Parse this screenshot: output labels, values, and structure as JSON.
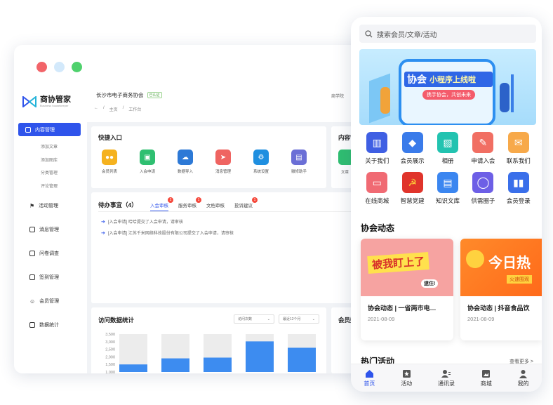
{
  "desktop": {
    "logo": {
      "title": "商协管家",
      "subtitle": "Business housekeeper"
    },
    "sidebar": {
      "active": "内容管理",
      "subitems": [
        "添加文章",
        "添加图库",
        "分类管理",
        "评论管理"
      ],
      "items": [
        "活动管理",
        "消息管理",
        "问卷调查",
        "签到管理",
        "会员管理",
        "数据统计"
      ]
    },
    "header": {
      "org": "长沙市电子商务协会",
      "tag": "已认证",
      "right": "商学院",
      "breadcrumb": [
        "←",
        "/",
        "主页",
        "/",
        "工作台"
      ]
    },
    "quick": {
      "title": "快捷入口",
      "items": [
        {
          "label": "会员列表",
          "color": "#f5b21f"
        },
        {
          "label": "入会申请",
          "color": "#2fbf71"
        },
        {
          "label": "数据导入",
          "color": "#2d79d6"
        },
        {
          "label": "消息管理",
          "color": "#ef6461"
        },
        {
          "label": "系统设置",
          "color": "#1f8fe0"
        },
        {
          "label": "徽修助手",
          "color": "#6b6fd6"
        }
      ]
    },
    "content_card": {
      "title": "内容管",
      "item": "文章"
    },
    "todo": {
      "title": "待办事宜（4）",
      "tabs": [
        {
          "label": "入会审核",
          "badge": "2"
        },
        {
          "label": "服务审核",
          "badge": "1"
        },
        {
          "label": "文档审核",
          "badge": ""
        },
        {
          "label": "投诉建议",
          "badge": "1"
        }
      ],
      "items": [
        "[入会申请] 哈哈提交了入会申请，请审核",
        "[入会申请] 江苏千米网络科技股份有限公司提交了入会申请，请审核"
      ]
    },
    "stats": {
      "title": "访问数据统计",
      "select1": "访问次数",
      "select2": "最近12个月",
      "member_title": "会员数"
    },
    "chart_data": {
      "type": "bar",
      "yticks": [
        "3,500",
        "3,000",
        "2,500",
        "2,000",
        "1,500",
        "1,000"
      ],
      "ylim": [
        1000,
        3500
      ],
      "values": [
        1500,
        1900,
        1950,
        3020,
        2600
      ],
      "colors": {
        "bar": "#3d8cf0",
        "bg": "#ececec"
      }
    }
  },
  "phone": {
    "search_placeholder": "搜索会员/文章/活动",
    "banner": {
      "title1": "协会",
      "title2": "小程序上线啦",
      "sub": "携手协会，共创未来"
    },
    "grid": [
      {
        "label": "关于我们",
        "color": "#3f5fe3",
        "icon": "building-icon"
      },
      {
        "label": "会员展示",
        "color": "#3a7bea",
        "icon": "diamond-icon"
      },
      {
        "label": "相册",
        "color": "#22c3b0",
        "icon": "image-icon"
      },
      {
        "label": "申请入会",
        "color": "#f16f63",
        "icon": "form-icon"
      },
      {
        "label": "联系我们",
        "color": "#f7a94a",
        "icon": "chat-icon"
      },
      {
        "label": "在线商城",
        "color": "#f06a73",
        "icon": "bag-icon"
      },
      {
        "label": "智慧党建",
        "color": "#e0342b",
        "icon": "party-icon"
      },
      {
        "label": "知识文库",
        "color": "#3b86f0",
        "icon": "doc-icon"
      },
      {
        "label": "供需圈子",
        "color": "#6d5fe6",
        "icon": "circle-icon"
      },
      {
        "label": "会员登录",
        "color": "#3a6fea",
        "icon": "login-icon"
      }
    ],
    "news_title": "协会动态",
    "news": [
      {
        "title": "协会动态 | 一省两市电…",
        "date": "2021-08-09",
        "img_text": "被我盯上了",
        "img_sub": "逮住!"
      },
      {
        "title": "协会动态 | 抖音食品饮",
        "date": "2021-08-09",
        "img_text": "今日热",
        "img_sub": "火速围观"
      }
    ],
    "hot_title": "热门活动",
    "more": "查看更多 >",
    "tabbar": [
      {
        "label": "首页",
        "icon": "home-icon",
        "active": true
      },
      {
        "label": "活动",
        "icon": "star-icon",
        "active": false
      },
      {
        "label": "通讯录",
        "icon": "contacts-icon",
        "active": false
      },
      {
        "label": "商城",
        "icon": "shop-icon",
        "active": false
      },
      {
        "label": "我的",
        "icon": "user-icon",
        "active": false
      }
    ]
  }
}
